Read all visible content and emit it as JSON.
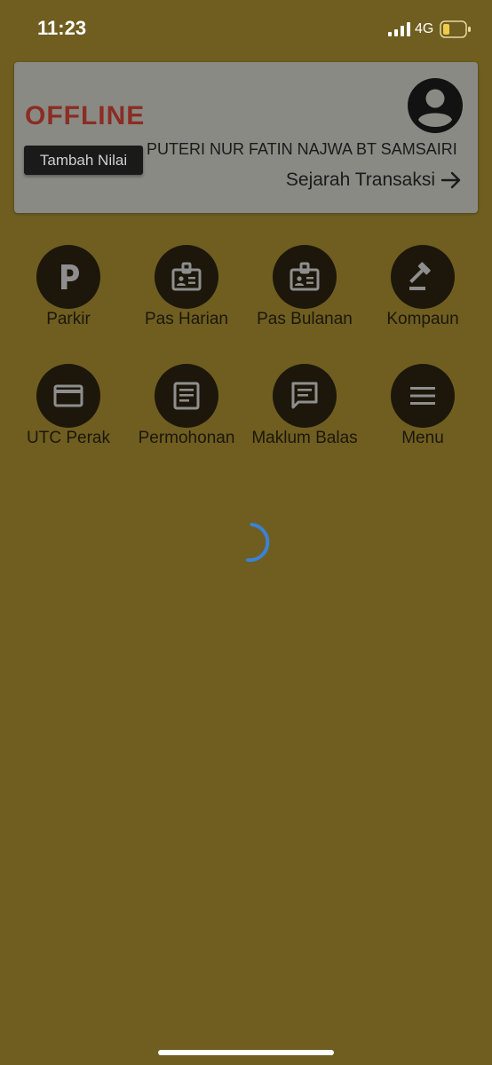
{
  "status_bar": {
    "time": "11:23",
    "network": "4G",
    "signal_icon": "cellular-signal-icon",
    "battery_icon": "battery-low-icon",
    "battery_color": "#f2c94c"
  },
  "profile": {
    "status": "OFFLINE",
    "status_color": "#8a2d24",
    "add_value_label": "Tambah Nilai",
    "name": "PUTERI NUR FATIN NAJWA BT SAMSAIRI",
    "history_label": "Sejarah Transaksi",
    "avatar_icon": "account-circle-icon",
    "arrow_icon": "arrow-right-icon"
  },
  "menu": [
    {
      "label": "Parkir",
      "icon": "parking-icon"
    },
    {
      "label": "Pas Harian",
      "icon": "badge-icon"
    },
    {
      "label": "Pas Bulanan",
      "icon": "badge-icon"
    },
    {
      "label": "Kompaun",
      "icon": "gavel-icon"
    },
    {
      "label": "UTC Perak",
      "icon": "credit-card-icon"
    },
    {
      "label": "Permohonan",
      "icon": "article-icon"
    },
    {
      "label": "Maklum Balas",
      "icon": "feedback-icon"
    },
    {
      "label": "Menu",
      "icon": "hamburger-menu-icon"
    }
  ],
  "colors": {
    "background": "#6f5e20",
    "spinner": "#3b82d6"
  }
}
